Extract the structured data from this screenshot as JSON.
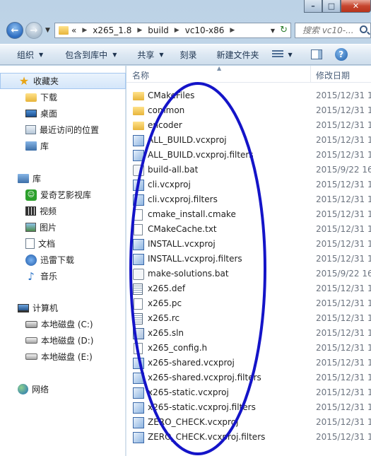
{
  "navbar": {
    "path": [
      "«",
      "x265_1.8",
      "build",
      "vc10-x86"
    ],
    "search_placeholder": "搜索 vc10-..."
  },
  "toolbar": {
    "organize": "组织",
    "include_library": "包含到库中",
    "share": "共享",
    "burn": "刻录",
    "new_folder": "新建文件夹"
  },
  "sidebar": {
    "favorites": {
      "header": "收藏夹",
      "items": [
        "下载",
        "桌面",
        "最近访问的位置",
        "库"
      ]
    },
    "libraries": {
      "header": "库",
      "items": [
        "爱奇艺影视库",
        "视频",
        "图片",
        "文档",
        "迅雷下载",
        "音乐"
      ]
    },
    "computer": {
      "header": "计算机",
      "items": [
        "本地磁盘 (C:)",
        "本地磁盘 (D:)",
        "本地磁盘 (E:)"
      ]
    },
    "network": {
      "header": "网络"
    }
  },
  "columns": {
    "name": "名称",
    "date": "修改日期"
  },
  "files": [
    {
      "name": "CMakeFiles",
      "date": "2015/12/31 1",
      "type": "folder"
    },
    {
      "name": "common",
      "date": "2015/12/31 1",
      "type": "folder"
    },
    {
      "name": "encoder",
      "date": "2015/12/31 1",
      "type": "folder"
    },
    {
      "name": "ALL_BUILD.vcxproj",
      "date": "2015/12/31 1",
      "type": "vcx"
    },
    {
      "name": "ALL_BUILD.vcxproj.filters",
      "date": "2015/12/31 1",
      "type": "vcx"
    },
    {
      "name": "build-all.bat",
      "date": "2015/9/22 16",
      "type": "bat"
    },
    {
      "name": "cli.vcxproj",
      "date": "2015/12/31 1",
      "type": "vcx"
    },
    {
      "name": "cli.vcxproj.filters",
      "date": "2015/12/31 1",
      "type": "vcx"
    },
    {
      "name": "cmake_install.cmake",
      "date": "2015/12/31 1",
      "type": "doc"
    },
    {
      "name": "CMakeCache.txt",
      "date": "2015/12/31 1",
      "type": "doc"
    },
    {
      "name": "INSTALL.vcxproj",
      "date": "2015/12/31 1",
      "type": "vcx"
    },
    {
      "name": "INSTALL.vcxproj.filters",
      "date": "2015/12/31 1",
      "type": "vcx"
    },
    {
      "name": "make-solutions.bat",
      "date": "2015/9/22 16",
      "type": "bat"
    },
    {
      "name": "x265.def",
      "date": "2015/12/31 1",
      "type": "def"
    },
    {
      "name": "x265.pc",
      "date": "2015/12/31 1",
      "type": "doc"
    },
    {
      "name": "x265.rc",
      "date": "2015/12/31 1",
      "type": "def"
    },
    {
      "name": "x265.sln",
      "date": "2015/12/31 1",
      "type": "sln"
    },
    {
      "name": "x265_config.h",
      "date": "2015/12/31 1",
      "type": "doc"
    },
    {
      "name": "x265-shared.vcxproj",
      "date": "2015/12/31 1",
      "type": "vcx"
    },
    {
      "name": "x265-shared.vcxproj.filters",
      "date": "2015/12/31 1",
      "type": "vcx"
    },
    {
      "name": "x265-static.vcxproj",
      "date": "2015/12/31 1",
      "type": "vcx"
    },
    {
      "name": "x265-static.vcxproj.filters",
      "date": "2015/12/31 1",
      "type": "vcx"
    },
    {
      "name": "ZERO_CHECK.vcxproj",
      "date": "2015/12/31 1",
      "type": "vcx"
    },
    {
      "name": "ZERO_CHECK.vcxproj.filters",
      "date": "2015/12/31 1",
      "type": "vcx"
    }
  ],
  "annotation": {
    "color": "#1414c8"
  }
}
